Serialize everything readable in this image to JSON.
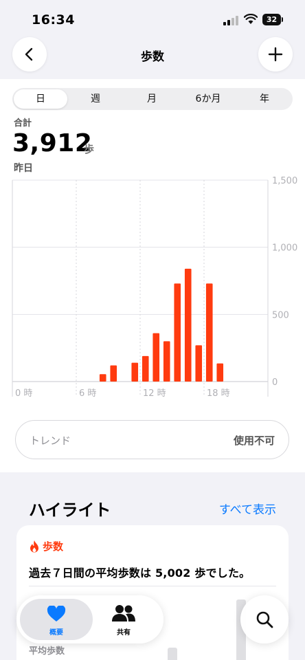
{
  "status_bar": {
    "time": "16:34",
    "battery": "32"
  },
  "nav": {
    "title": "歩数"
  },
  "segments": {
    "items": [
      "日",
      "週",
      "月",
      "6か月",
      "年"
    ],
    "selected": "日"
  },
  "summary": {
    "label": "合計",
    "value": "3,912",
    "unit": "歩",
    "date": "昨日"
  },
  "chart_data": {
    "type": "bar",
    "x": [
      8,
      9,
      11,
      12,
      13,
      14,
      15,
      16,
      17,
      18,
      19
    ],
    "values": [
      55,
      120,
      140,
      190,
      360,
      300,
      730,
      840,
      270,
      730,
      135
    ],
    "x_ticks": [
      "0 時",
      "6 時",
      "12 時",
      "18 時"
    ],
    "y_ticks": [
      "1,500",
      "1,000",
      "500",
      "0"
    ],
    "xlim": [
      0,
      24
    ],
    "ylim": [
      0,
      1500
    ],
    "bar_color": "#ff3b0f",
    "grid": true
  },
  "trend": {
    "label": "トレンド",
    "status": "使用不可"
  },
  "highlights": {
    "title": "ハイライト",
    "show_all": "すべて表示",
    "card_title": "歩数",
    "card_text": "過去７日間の平均歩数は 5,002 歩でした。",
    "card_sub": "平均歩数"
  },
  "tabbar": {
    "summary_label": "概要",
    "sharing_label": "共有"
  },
  "colors": {
    "accent": "#ff3b0f",
    "link": "#0a7aff",
    "tab_heart": "#0a7aff"
  }
}
